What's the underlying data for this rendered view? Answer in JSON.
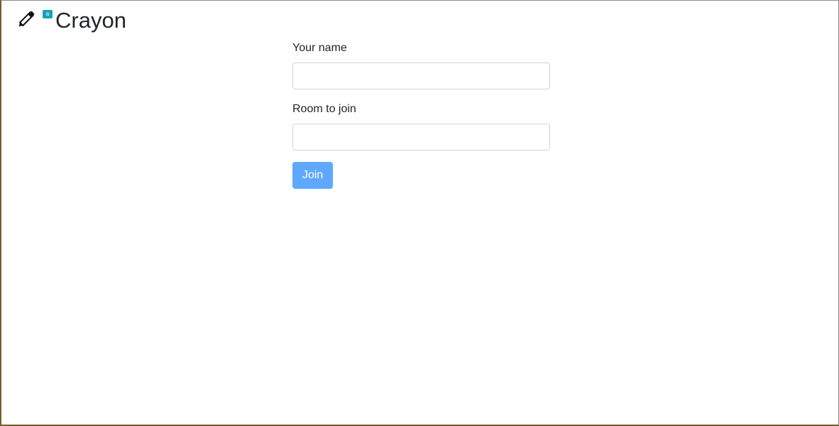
{
  "app": {
    "title": "Crayon",
    "badge": "a",
    "logo_icon": "pencil-icon",
    "badge_color": "#17a2b8"
  },
  "form": {
    "name_label": "Your name",
    "name_value": "",
    "name_placeholder": "",
    "room_label": "Room to join",
    "room_value": "",
    "room_placeholder": "",
    "join_label": "Join",
    "join_color": "#5fa8ff"
  }
}
